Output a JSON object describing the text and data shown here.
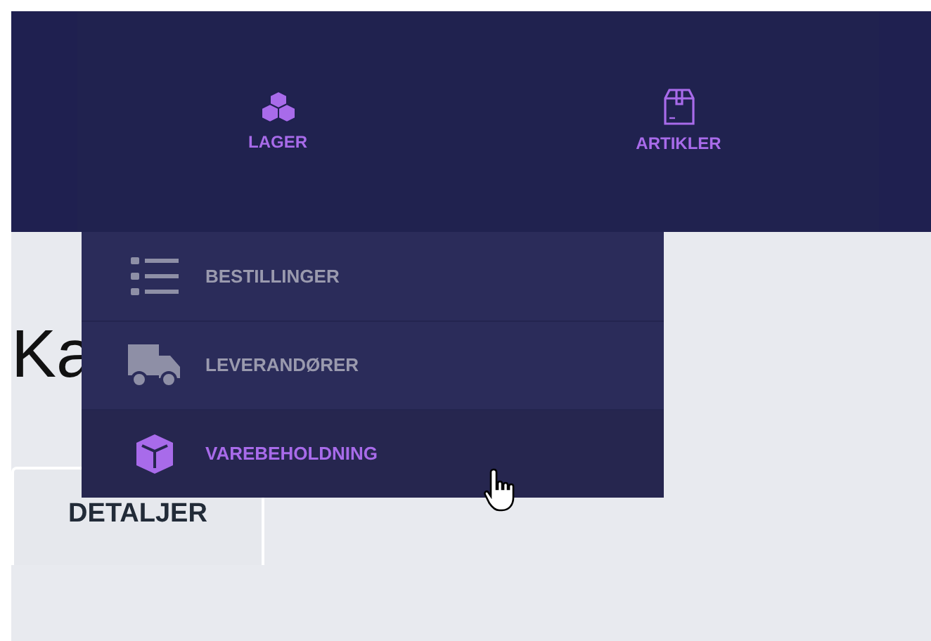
{
  "nav": [
    {
      "label": "LAGER",
      "kind": "cubes"
    },
    {
      "label": "ARTIKLER",
      "kind": "box"
    }
  ],
  "dropdown": [
    {
      "label": "BESTILLINGER",
      "kind": "list",
      "selected": false
    },
    {
      "label": "LEVERANDØRER",
      "kind": "truck",
      "selected": false
    },
    {
      "label": "VAREBEHOLDNING",
      "kind": "cube",
      "selected": true
    }
  ],
  "heading": "Ka",
  "tabs": [
    {
      "label": "DETALJER"
    }
  ]
}
